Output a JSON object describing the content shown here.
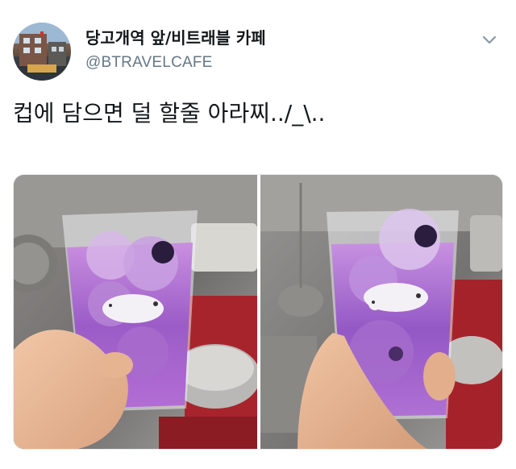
{
  "account": {
    "display_name": "당고개역 앞/비트래블 카페",
    "handle": "@BTRAVELCAFE",
    "avatar_icon": "avatar-photo-icon"
  },
  "actions": {
    "more_icon": "chevron-down-icon"
  },
  "tweet": {
    "text": "컵에 담으면 덜 할줄 아라찌../_\\.."
  },
  "media": {
    "photo_count": 2,
    "photos": [
      {
        "icon": "drink-photo-left-icon"
      },
      {
        "icon": "drink-photo-right-icon"
      }
    ]
  },
  "colors": {
    "text_primary": "#14171a",
    "text_secondary": "#657786",
    "border": "#e6ecf0",
    "drink_purple": "#9b5fc7",
    "mixer_red": "#b3202a"
  }
}
